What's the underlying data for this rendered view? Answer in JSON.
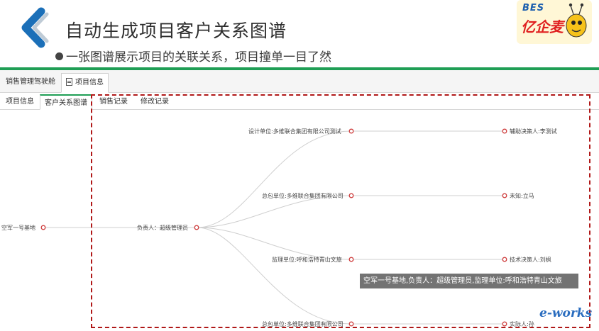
{
  "slide": {
    "title": "自动生成项目客户关系图谱",
    "subtitle": "一张图谱展示项目的关联关系，项目撞单一目了然",
    "accent_color": "#1f9e55",
    "highlight_color": "#b01818"
  },
  "logo": {
    "brand": "BES",
    "name": "亿企麦"
  },
  "top_tabs": [
    {
      "label": "销售管理驾驶舱",
      "active": false
    },
    {
      "label": "项目信息",
      "active": true,
      "icon": "document-icon"
    }
  ],
  "sub_tabs": [
    {
      "label": "项目信息",
      "active": false
    },
    {
      "label": "客户关系图谱",
      "active": true
    },
    {
      "label": "销售记录",
      "active": false
    },
    {
      "label": "修改记录",
      "active": false
    }
  ],
  "graph": {
    "root": "空军一号基地",
    "owner": "负责人：超级管理员",
    "units": [
      "设计单位:多维联合集团有限公司测试",
      "总包单位:多维联合集团有限公司",
      "监理单位:呼和浩特青山文旅",
      "总包单位:多维联合集团有限公司"
    ],
    "contacts": [
      "辅助决策人:李测试",
      "未知:立马",
      "技术决策人:刘枫",
      "实际人:孙"
    ]
  },
  "tooltip": "空军一号基地,负责人：超级管理员,监理单位:呼和浩特青山文旅",
  "watermark": "e-works"
}
